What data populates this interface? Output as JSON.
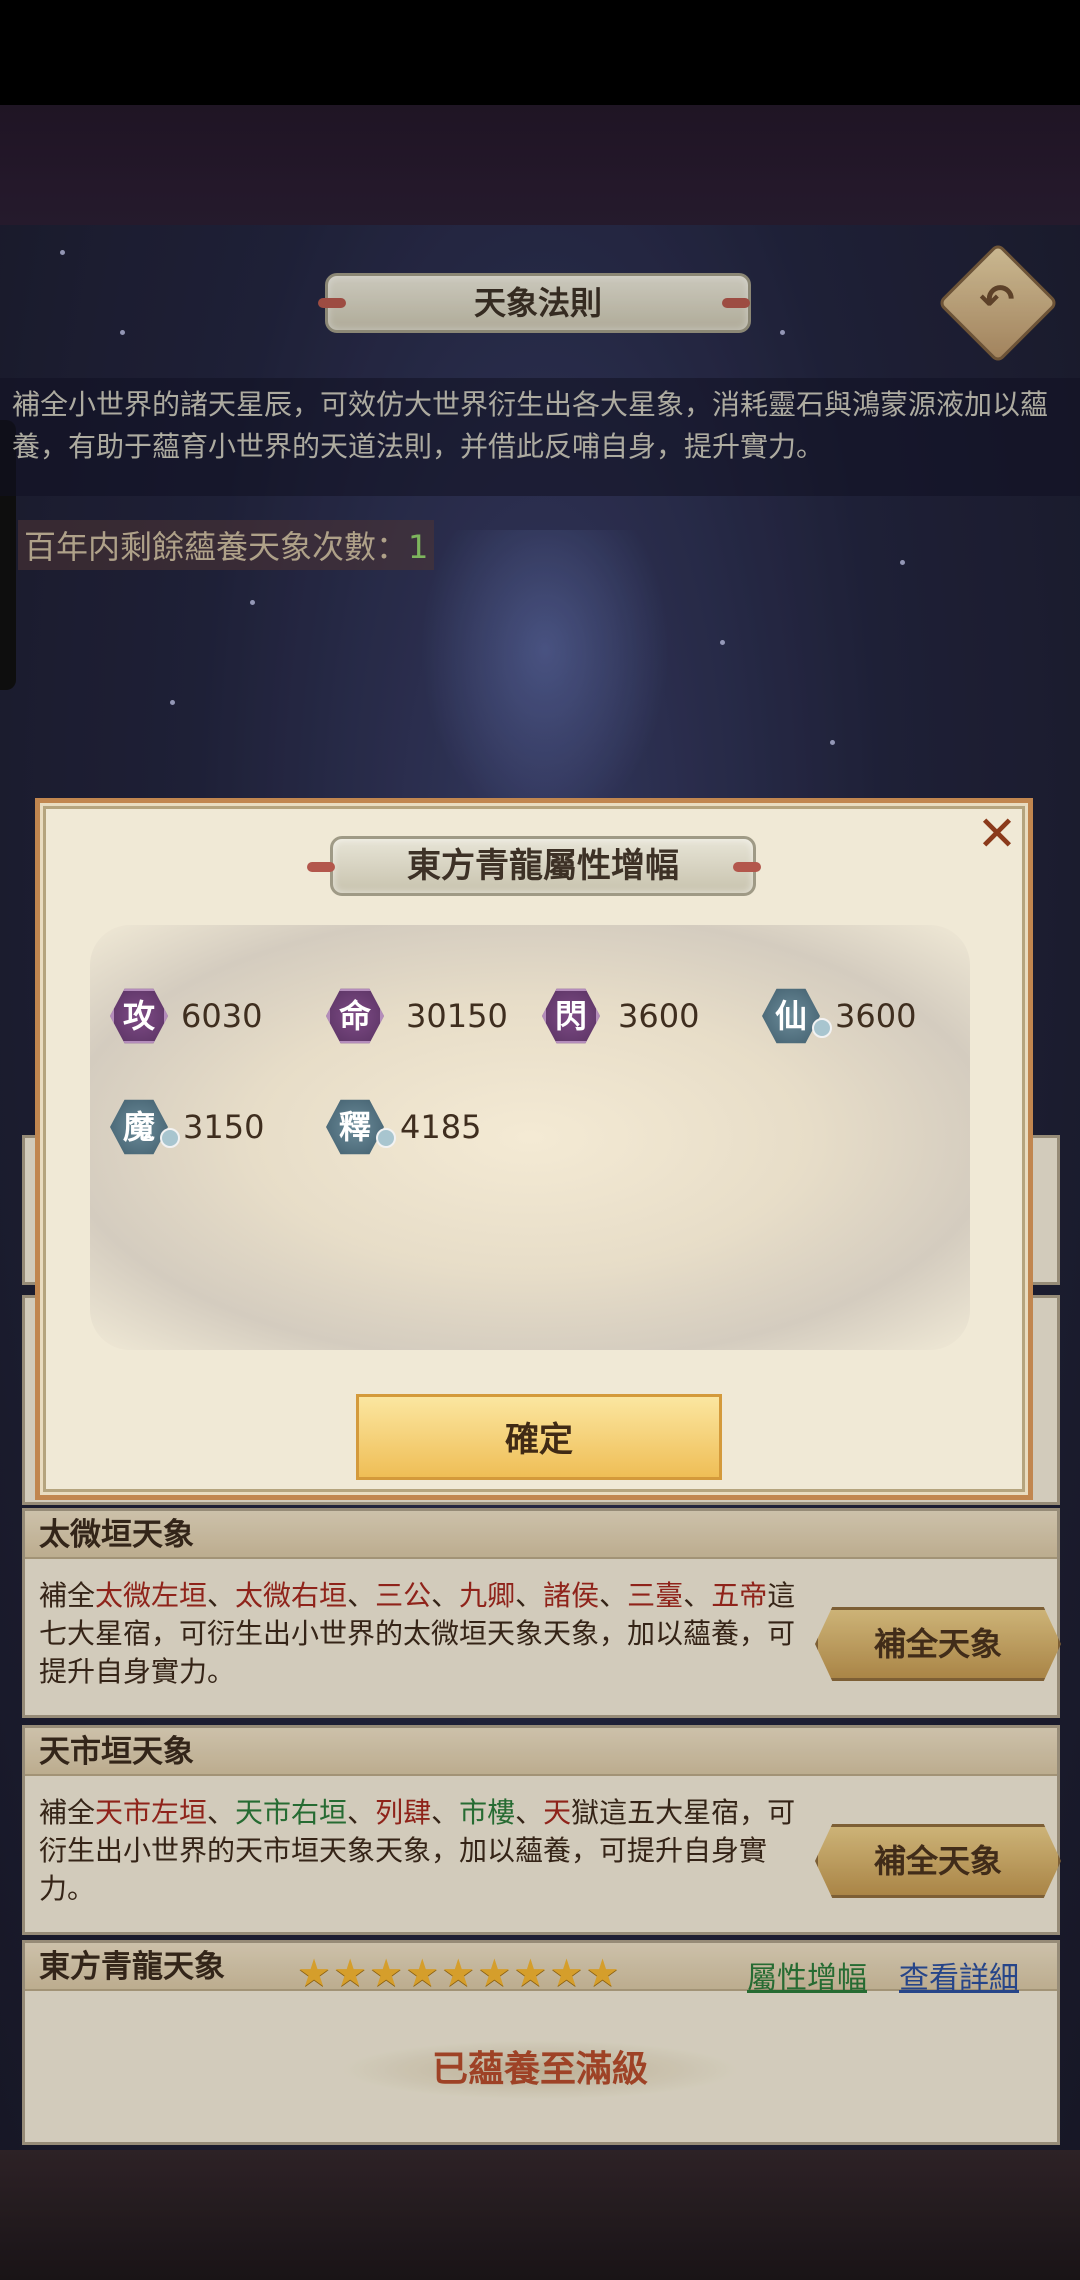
{
  "header": {
    "title": "天象法則",
    "description": "補全小世界的諸天星辰，可效仿大世界衍生出各大星象，消耗靈石與鴻蒙源液加以蘊養，有助于蘊育小世界的天道法則，并借此反哺自身，提升實力。",
    "remaining_label": "百年内剩餘蘊養天象次數：",
    "remaining_value": "1"
  },
  "modal": {
    "title": "東方青龍屬性增幅",
    "close_icon": "close-icon",
    "attributes": [
      {
        "glyph": "攻",
        "value": "6030",
        "style": "purple"
      },
      {
        "glyph": "命",
        "value": "30150",
        "style": "purple"
      },
      {
        "glyph": "閃",
        "value": "3600",
        "style": "purple"
      },
      {
        "glyph": "仙",
        "value": "3600",
        "style": "teal"
      },
      {
        "glyph": "魔",
        "value": "3150",
        "style": "teal"
      },
      {
        "glyph": "釋",
        "value": "4185",
        "style": "teal"
      }
    ],
    "confirm_label": "確定"
  },
  "sections": [
    {
      "title": "太微垣天象",
      "text_parts": [
        "補全",
        "太微左垣",
        "、",
        "太微右垣",
        "、",
        "三公",
        "、",
        "九卿",
        "、",
        "諸侯",
        "、",
        "三臺",
        "、",
        "五帝",
        "這七大星宿，可衍生出小世界的太微垣天象天象，加以蘊養，可提升自身實力。"
      ],
      "button_label": "補全天象"
    },
    {
      "title": "天市垣天象",
      "text_parts": [
        "補全",
        "天市左垣",
        "、",
        "天市右垣",
        "、",
        "列肆",
        "、",
        "市樓",
        "、",
        "天",
        "獄",
        "這五大星宿，可衍生出小世界的天市垣天象天象，加以蘊養，可提升自身實力。"
      ],
      "button_label": "補全天象"
    },
    {
      "title": "東方青龍天象",
      "stars": "★★★★★★★★★",
      "star_count": 9,
      "link_attr": "屬性增幅",
      "link_detail": "查看詳細",
      "status": "已蘊養至滿級"
    }
  ],
  "colors": {
    "accent_red": "#a3281e",
    "accent_green": "#2c7a3a",
    "star_gold": "#f3b432",
    "button_gold": "#efbe56"
  }
}
